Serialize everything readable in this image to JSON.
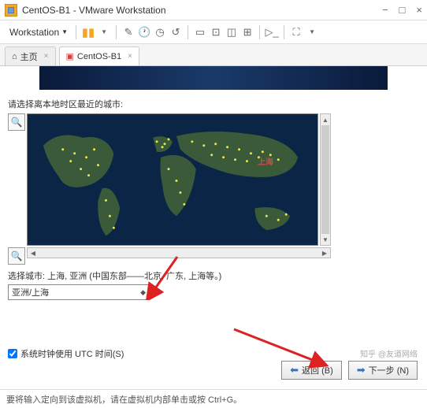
{
  "window": {
    "title": "CentOS-B1 - VMware Workstation",
    "minimize": "−",
    "maximize": "□",
    "close": "×"
  },
  "menu": {
    "workstation": "Workstation"
  },
  "tabs": {
    "home": "主页",
    "vm": "CentOS-B1",
    "close": "×"
  },
  "timezone": {
    "prompt": "请选择离本地时区最近的城市:",
    "selected_marker": "上海",
    "city_desc_label": "选择城市:",
    "city_desc": "上海, 亚洲 (中国东部——北京, 广东, 上海等。)",
    "combo_value": "亚洲/上海",
    "utc_label": "系统时钟使用 UTC 时间(S)"
  },
  "buttons": {
    "back": "返回 (B)",
    "next": "下一步 (N)"
  },
  "footer": {
    "hint": "要将输入定向到该虚拟机，请在虚拟机内部单击或按 Ctrl+G。"
  },
  "watermark": "知乎 @友道网络"
}
